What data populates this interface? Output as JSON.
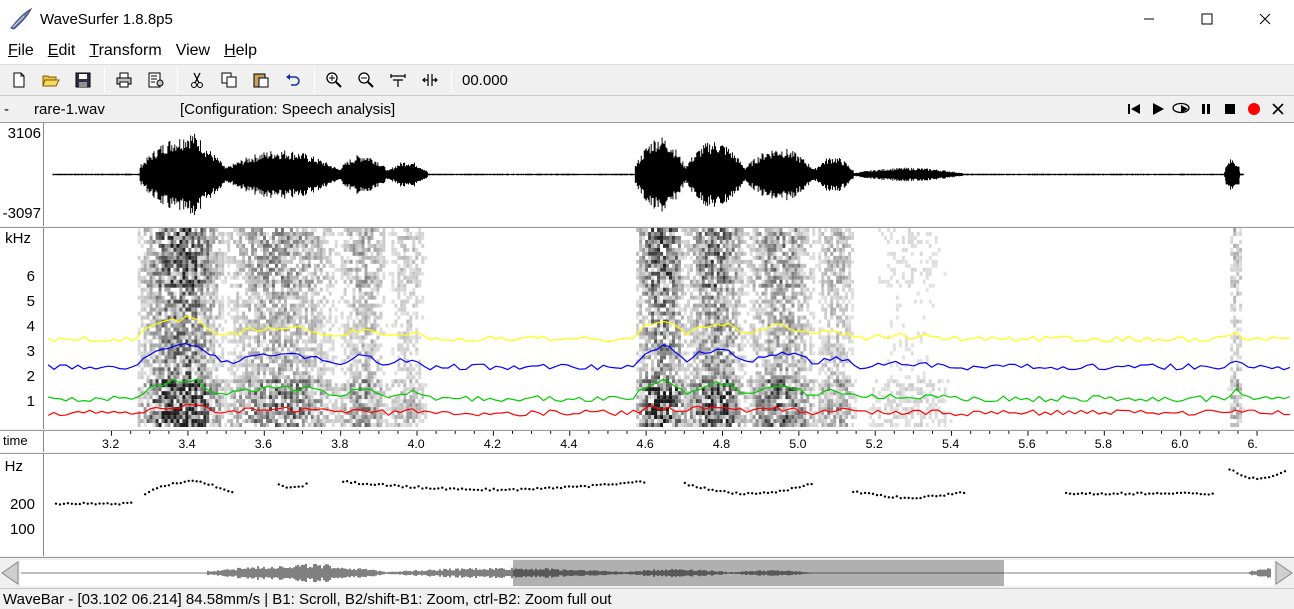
{
  "window": {
    "title": "WaveSurfer 1.8.8p5",
    "controls": [
      "minimize",
      "maximize",
      "close"
    ]
  },
  "menu": [
    {
      "label": "File",
      "accel": "F"
    },
    {
      "label": "Edit",
      "accel": "E"
    },
    {
      "label": "Transform",
      "accel": "T"
    },
    {
      "label": "View",
      "accel": ""
    },
    {
      "label": "Help",
      "accel": "H"
    }
  ],
  "toolbar": {
    "time_value": "00.000",
    "icons": [
      "new-file-icon",
      "open-folder-icon",
      "save-icon",
      "print-icon",
      "properties-icon",
      "cut-icon",
      "copy-icon",
      "paste-icon",
      "undo-icon",
      "zoom-in-icon",
      "zoom-out-icon",
      "zoom-selection-icon",
      "zoom-full-icon"
    ]
  },
  "panel": {
    "dash": "-",
    "filename": "rare-1.wav",
    "configuration": "[Configuration: Speech analysis]",
    "transport": [
      "skip-start-icon",
      "play-icon",
      "play-loop-icon",
      "pause-icon",
      "stop-icon",
      "record-icon",
      "close-icon"
    ]
  },
  "waveform": {
    "max_label": "3106",
    "min_label": "-3097"
  },
  "spectrogram": {
    "unit_label": "kHz",
    "tick_labels": [
      "6",
      "5",
      "4",
      "3",
      "2",
      "1"
    ],
    "formant_colors": {
      "f1": "#ff0000",
      "f2": "#00cc00",
      "f3": "#0000ff",
      "f4": "#ffff00"
    }
  },
  "timeaxis": {
    "label": "time",
    "ticks": [
      "3.2",
      "3.4",
      "3.6",
      "3.8",
      "4.0",
      "4.2",
      "4.4",
      "4.6",
      "4.8",
      "5.0",
      "5.2",
      "5.4",
      "5.6",
      "5.8",
      "6.0",
      "6."
    ]
  },
  "pitch": {
    "unit_label": "Hz",
    "tick_labels": [
      "200",
      "100"
    ]
  },
  "wavebar": {
    "left_arrow": "scroll-left-icon",
    "right_arrow": "scroll-right-icon"
  },
  "status": {
    "text": "WaveBar - [03.102 06.214] 84.58mm/s | B1: Scroll, B2/shift-B1: Zoom, ctrl-B2: Zoom full out"
  }
}
